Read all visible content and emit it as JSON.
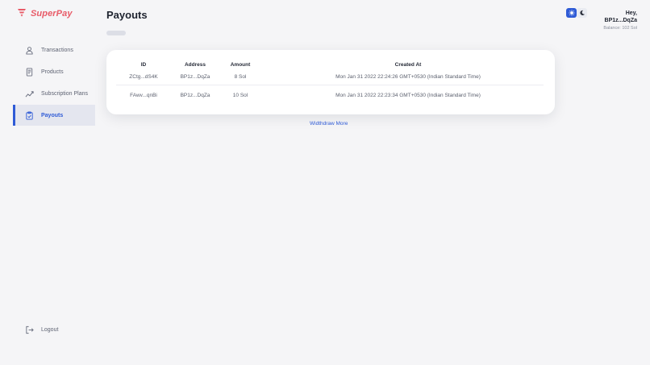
{
  "brand": {
    "name": "SuperPay"
  },
  "sidebar": {
    "items": [
      {
        "label": "Transactions",
        "icon": "user-icon"
      },
      {
        "label": "Products",
        "icon": "receipt-icon"
      },
      {
        "label": "Subscription Plans",
        "icon": "trend-icon"
      },
      {
        "label": "Payouts",
        "icon": "clipboard-check-icon",
        "active": true
      }
    ],
    "logout_label": "Logout"
  },
  "page": {
    "title": "Payouts"
  },
  "table": {
    "headers": {
      "id": "ID",
      "address": "Address",
      "amount": "Amount",
      "created_at": "Created At"
    },
    "rows": [
      {
        "id": "ZCtg...dS4K",
        "address": "BP1z...DqZa",
        "amount": "8 Sol",
        "created_at": "Mon Jan 31 2022 22:24:26 GMT+0530 (Indian Standard Time)"
      },
      {
        "id": "FAwv...qnBi",
        "address": "BP1z...DqZa",
        "amount": "10 Sol",
        "created_at": "Mon Jan 31 2022 22:23:34 GMT+0530 (Indian Standard Time)"
      }
    ]
  },
  "withdraw_more_label": "Widthdraw More",
  "user": {
    "greeting": "Hey,",
    "wallet": "BP1z...DqZa",
    "balance": "Balance: 102 Sol"
  },
  "theme": {
    "selected": "light"
  },
  "colors": {
    "brand": "#e85a67",
    "accent": "#2f5bd6",
    "background": "#f5f5f7"
  }
}
